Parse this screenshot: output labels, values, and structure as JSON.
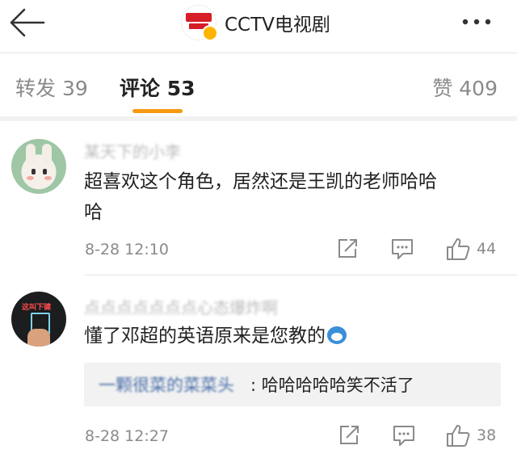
{
  "header": {
    "title": "CCTV电视剧",
    "back_icon": "back-arrow-icon",
    "more_icon": "more-dots-icon",
    "logo_icon": "cctv-drama-logo",
    "colors": {
      "logo_red": "#d71d25",
      "verified": "#ffb400"
    }
  },
  "tabs": [
    {
      "label": "转发 39",
      "active": false
    },
    {
      "label": "评论 53",
      "active": true
    },
    {
      "label": "赞 409",
      "active": false
    }
  ],
  "accent_color": "#f59a13",
  "comments": [
    {
      "username": "某天下的小李",
      "text_line1": "超喜欢这个角色，居然还是王凯的老师哈哈",
      "text_line2": "哈",
      "timestamp": "8-28 12:10",
      "likes": "44"
    },
    {
      "username": "点点点点点点点心态爆炸啊",
      "avatar_tag": "这叫下键",
      "text": "懂了邓超的英语原来是您教的",
      "emoji": "doraemon-emoji",
      "reply": {
        "user": "一颗很菜的菜菜头",
        "text": ": 哈哈哈哈哈笑不活了"
      },
      "timestamp": "8-28 12:27",
      "likes": "38"
    }
  ]
}
